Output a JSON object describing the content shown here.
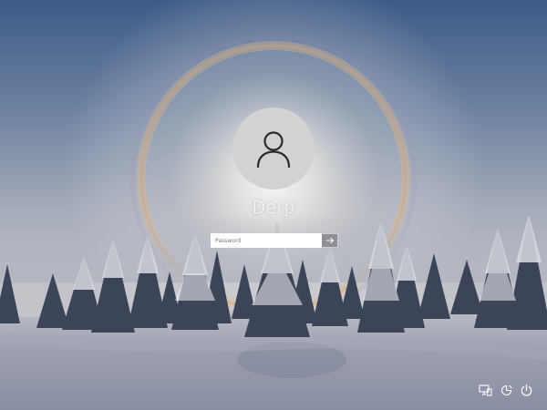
{
  "user": {
    "name": "Derp"
  },
  "password": {
    "placeholder": "Password",
    "value": ""
  },
  "corner_icons": [
    "network-icon",
    "ease-of-access-icon",
    "power-icon"
  ],
  "colors": {
    "avatar_background": "#d2d2d2",
    "submit_button": "#8e8e96"
  }
}
